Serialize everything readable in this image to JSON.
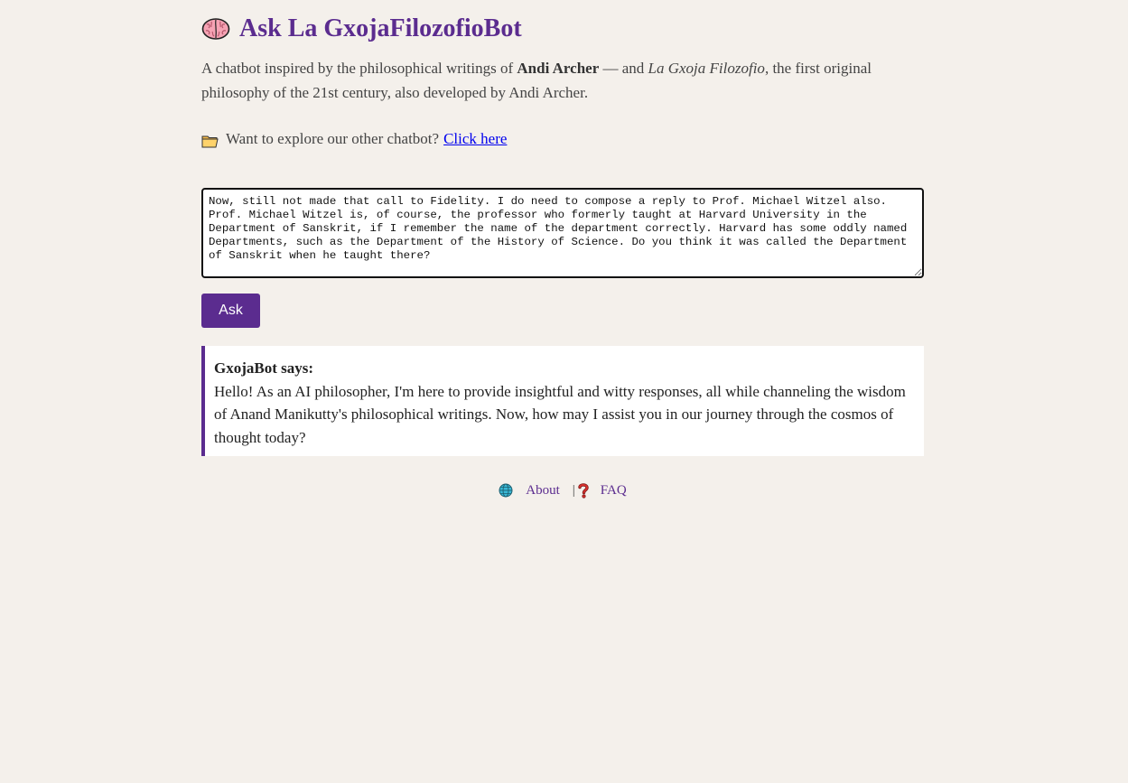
{
  "header": {
    "icon": "brain-icon",
    "title": "Ask La GxojaFilozofioBot"
  },
  "intro": {
    "prefix": "A chatbot inspired by the philosophical writings of ",
    "author": "Andi Archer",
    "middle": " — and ",
    "work": "La Gxoja Filozofio",
    "suffix": ", the first original philosophy of the 21st century, also developed by Andi Archer."
  },
  "explore": {
    "icon": "folder-icon",
    "text": "Want to explore our other chatbot?",
    "link_label": "Click here"
  },
  "question": {
    "value": "Now, still not made that call to Fidelity. I do need to compose a reply to Prof. Michael Witzel also. Prof. Michael Witzel is, of course, the professor who formerly taught at Harvard University in the Department of Sanskrit, if I remember the name of the department correctly. Harvard has some oddly named Departments, such as the Department of the History of Science. Do you think it was called the Department of Sanskrit when he taught there?"
  },
  "ask_button": {
    "label": "Ask"
  },
  "response": {
    "speaker": "GxojaBot says:",
    "text": "Hello! As an AI philosopher, I'm here to provide insightful and witty responses, all while channeling the wisdom of Anand Manikutty's philosophical writings. Now, how may I assist you in our journey through the cosmos of thought today?"
  },
  "footer": {
    "about_icon": "globe-icon",
    "about_label": "About",
    "separator": "|",
    "faq_icon": "question-mark-icon",
    "faq_label": "FAQ"
  },
  "colors": {
    "background": "#f4f0eb",
    "accent": "#5b2c8f",
    "link": "#0000ee"
  }
}
